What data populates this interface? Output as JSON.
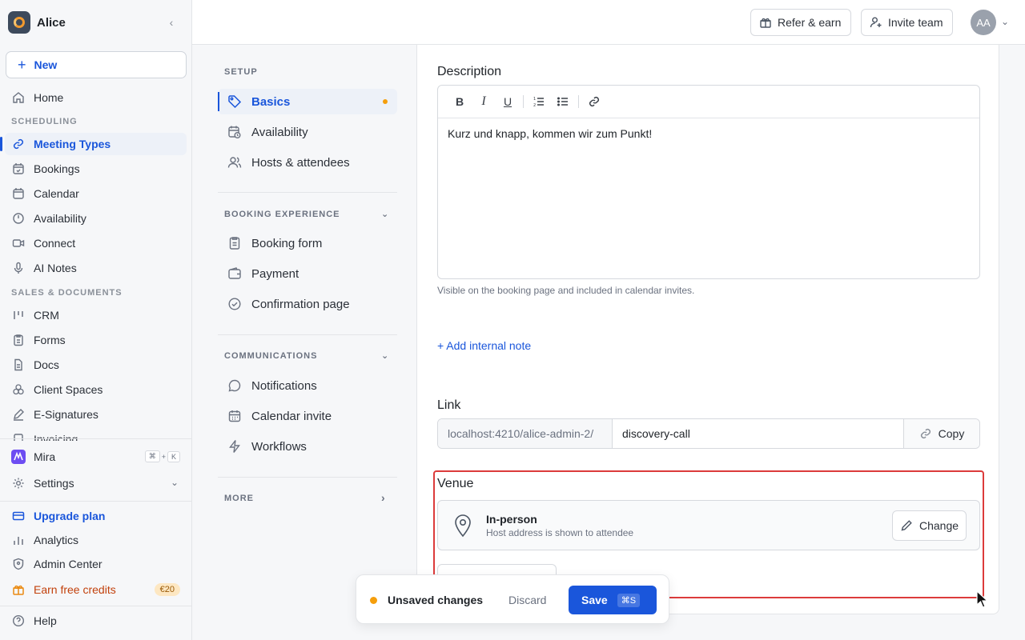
{
  "brand": {
    "name": "Alice"
  },
  "sidebar": {
    "new_label": "New",
    "home": "Home",
    "section_scheduling": "SCHEDULING",
    "scheduling_items": [
      "Meeting Types",
      "Bookings",
      "Calendar",
      "Availability",
      "Connect",
      "AI Notes"
    ],
    "section_sales": "SALES & DOCUMENTS",
    "sales_items": [
      "CRM",
      "Forms",
      "Docs",
      "Client Spaces",
      "E-Signatures",
      "Invoicing"
    ],
    "mira": "Mira",
    "mira_kbd": [
      "⌘",
      "+",
      "K"
    ],
    "settings": "Settings",
    "upgrade": "Upgrade plan",
    "analytics": "Analytics",
    "admin": "Admin Center",
    "earn": "Earn free credits",
    "earn_badge": "€20",
    "help": "Help"
  },
  "topbar": {
    "refer": "Refer & earn",
    "invite": "Invite team",
    "avatar_initials": "AA"
  },
  "subnav": {
    "setup": "SETUP",
    "setup_items": [
      "Basics",
      "Availability",
      "Hosts & attendees"
    ],
    "booking": "BOOKING EXPERIENCE",
    "booking_items": [
      "Booking form",
      "Payment",
      "Confirmation page"
    ],
    "comms": "COMMUNICATIONS",
    "comms_items": [
      "Notifications",
      "Calendar invite",
      "Workflows"
    ],
    "more": "MORE"
  },
  "main": {
    "description_label": "Description",
    "description_text": "Kurz und knapp, kommen wir zum Punkt!",
    "description_helper": "Visible on the booking page and included in calendar invites.",
    "add_note": "+ Add internal note",
    "link_label": "Link",
    "link_prefix": "localhost:4210/alice-admin-2/",
    "link_slug": "discovery-call",
    "copy": "Copy",
    "venue_label": "Venue",
    "venue_title": "In-person",
    "venue_sub": "Host address is shown to attendee",
    "change": "Change"
  },
  "unsaved": {
    "text": "Unsaved changes",
    "discard": "Discard",
    "save": "Save",
    "save_kbd": "⌘S"
  },
  "colors": {
    "accent": "#1a56db",
    "highlight": "#dc3b3b",
    "warning": "#f59e0b"
  }
}
